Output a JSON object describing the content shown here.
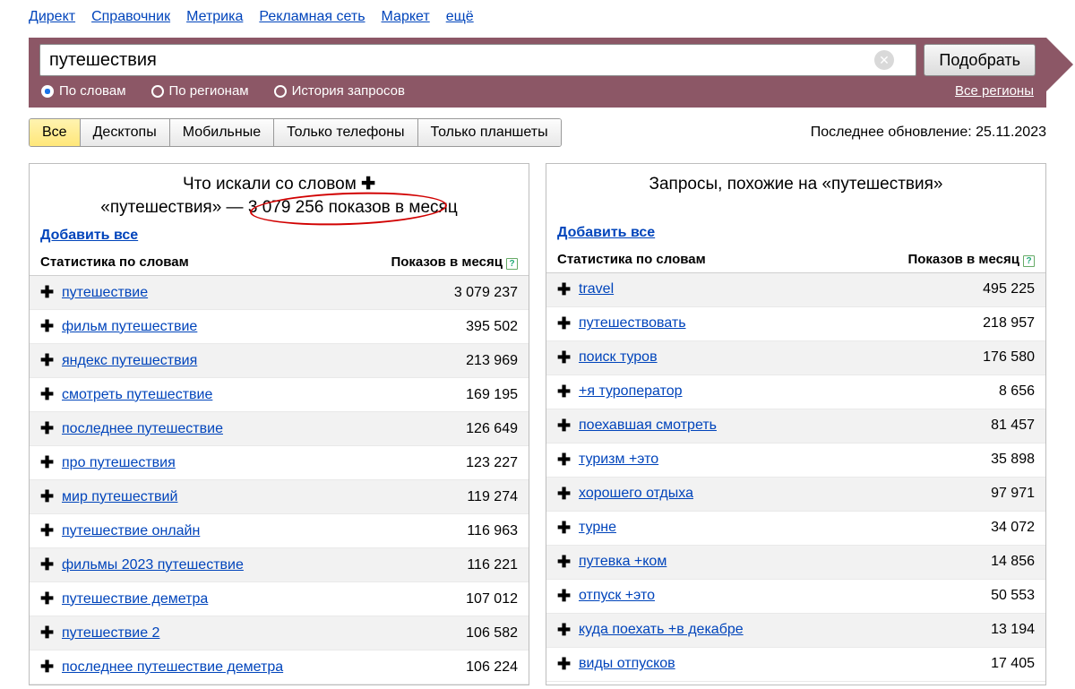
{
  "topnav": [
    "Директ",
    "Справочник",
    "Метрика",
    "Рекламная сеть",
    "Маркет",
    "ещё"
  ],
  "search": {
    "value": "путешествия",
    "button": "Подобрать",
    "radios": [
      {
        "label": "По словам",
        "selected": true
      },
      {
        "label": "По регионам",
        "selected": false
      },
      {
        "label": "История запросов",
        "selected": false
      }
    ],
    "regions": "Все регионы"
  },
  "device_tabs": [
    "Все",
    "Десктопы",
    "Мобильные",
    "Только телефоны",
    "Только планшеты"
  ],
  "device_active": 0,
  "updated": "Последнее обновление: 25.11.2023",
  "left": {
    "title_line1": "Что искали со словом",
    "title_line2_pre": "«путешествия» — ",
    "title_line2_count": "3 079 256 показов",
    "title_line2_post": " в месяц",
    "add_all": "Добавить все",
    "col1": "Статистика по словам",
    "col2": "Показов в месяц",
    "rows": [
      {
        "kw": "путешествие",
        "v": "3 079 237"
      },
      {
        "kw": "фильм путешествие",
        "v": "395 502"
      },
      {
        "kw": "яндекс путешествия",
        "v": "213 969"
      },
      {
        "kw": "смотреть путешествие",
        "v": "169 195"
      },
      {
        "kw": "последнее путешествие",
        "v": "126 649"
      },
      {
        "kw": "про путешествия",
        "v": "123 227"
      },
      {
        "kw": "мир путешествий",
        "v": "119 274"
      },
      {
        "kw": "путешествие онлайн",
        "v": "116 963"
      },
      {
        "kw": "фильмы 2023 путешествие",
        "v": "116 221"
      },
      {
        "kw": "путешествие деметра",
        "v": "107 012"
      },
      {
        "kw": "путешествие 2",
        "v": "106 582"
      },
      {
        "kw": "последнее путешествие деметра",
        "v": "106 224"
      }
    ]
  },
  "right": {
    "title": "Запросы, похожие на «путешествия»",
    "add_all": "Добавить все",
    "col1": "Статистика по словам",
    "col2": "Показов в месяц",
    "rows": [
      {
        "kw": "travel",
        "v": "495 225"
      },
      {
        "kw": "путешествовать",
        "v": "218 957"
      },
      {
        "kw": "поиск туров",
        "v": "176 580"
      },
      {
        "kw": "+я туроператор",
        "v": "8 656"
      },
      {
        "kw": "поехавшая смотреть",
        "v": "81 457"
      },
      {
        "kw": "туризм +это",
        "v": "35 898"
      },
      {
        "kw": "хорошего отдыха",
        "v": "97 971"
      },
      {
        "kw": "турне",
        "v": "34 072"
      },
      {
        "kw": "путевка +ком",
        "v": "14 856"
      },
      {
        "kw": "отпуск +это",
        "v": "50 553"
      },
      {
        "kw": "куда поехать +в декабре",
        "v": "13 194"
      },
      {
        "kw": "виды отпусков",
        "v": "17 405"
      }
    ]
  }
}
